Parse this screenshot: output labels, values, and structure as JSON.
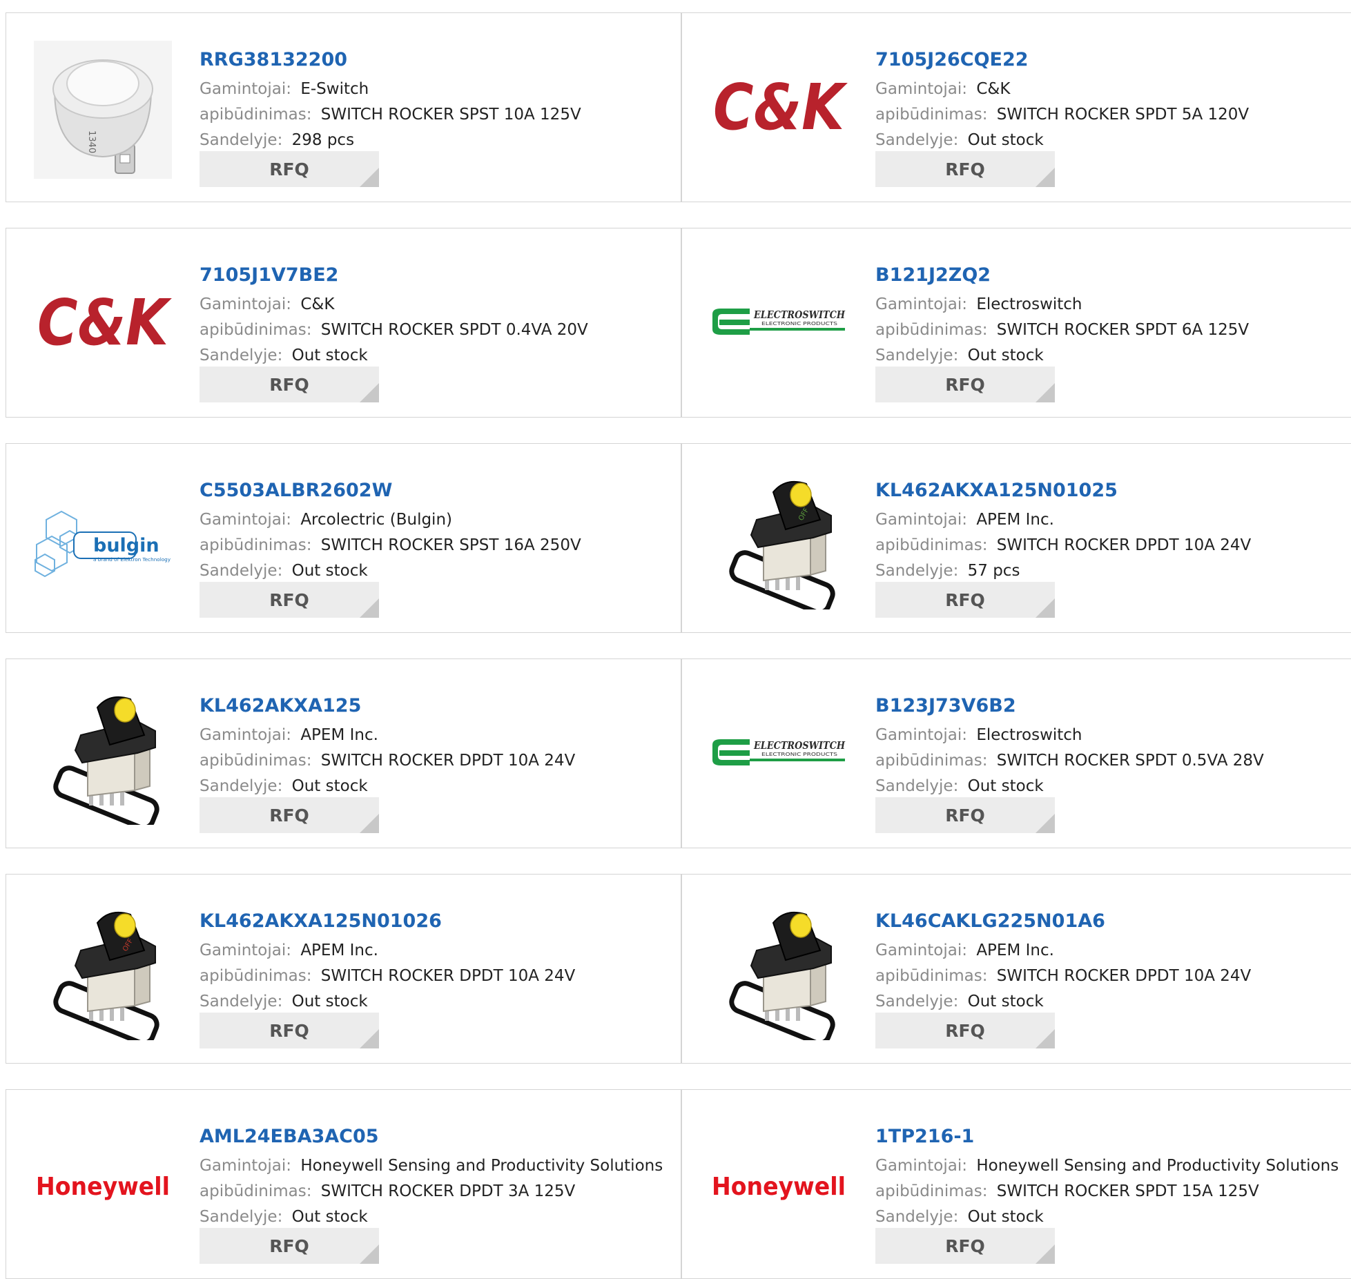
{
  "labels": {
    "manufacturer": "Gamintojai:",
    "description": "apibūdinimas:",
    "stock": "Sandelyje:",
    "rfq": "RFQ"
  },
  "products": [
    {
      "part": "RRG38132200",
      "manufacturer": "E-Switch",
      "description": "SWITCH ROCKER SPST 10A 125V",
      "stock": "298 pcs",
      "image": "round-switch",
      "image_text": "1340"
    },
    {
      "part": "7105J26CQE22",
      "manufacturer": "C&K",
      "description": "SWITCH ROCKER SPDT 5A 120V",
      "stock": "Out stock",
      "image": "ck-logo",
      "image_text": "C&K"
    },
    {
      "part": "7105J1V7BE2",
      "manufacturer": "C&K",
      "description": "SWITCH ROCKER SPDT 0.4VA 20V",
      "stock": "Out stock",
      "image": "ck-logo",
      "image_text": "C&K"
    },
    {
      "part": "B121J2ZQ2",
      "manufacturer": "Electroswitch",
      "description": "SWITCH ROCKER SPDT 6A 125V",
      "stock": "Out stock",
      "image": "electroswitch-logo",
      "image_text": "ELECTROSWITCH",
      "image_subtext": "ELECTRONIC PRODUCTS"
    },
    {
      "part": "C5503ALBR2602W",
      "manufacturer": "Arcolectric (Bulgin)",
      "description": "SWITCH ROCKER SPST 16A 250V",
      "stock": "Out stock",
      "image": "bulgin-logo",
      "image_text": "bulgin",
      "image_subtext": "a brand of Elektron Technology"
    },
    {
      "part": "KL462AKXA125N01025",
      "manufacturer": "APEM Inc.",
      "description": "SWITCH ROCKER DPDT 10A 24V",
      "stock": "57 pcs",
      "image": "rocker-switch",
      "image_text": "OFF",
      "accent": "#5a9a3c"
    },
    {
      "part": "KL462AKXA125",
      "manufacturer": "APEM Inc.",
      "description": "SWITCH ROCKER DPDT 10A 24V",
      "stock": "Out stock",
      "image": "rocker-switch",
      "image_text": "",
      "accent": "#333333"
    },
    {
      "part": "B123J73V6B2",
      "manufacturer": "Electroswitch",
      "description": "SWITCH ROCKER SPDT 0.5VA 28V",
      "stock": "Out stock",
      "image": "electroswitch-logo",
      "image_text": "ELECTROSWITCH",
      "image_subtext": "ELECTRONIC PRODUCTS"
    },
    {
      "part": "KL462AKXA125N01026",
      "manufacturer": "APEM Inc.",
      "description": "SWITCH ROCKER DPDT 10A 24V",
      "stock": "Out stock",
      "image": "rocker-switch",
      "image_text": "OFF",
      "accent": "#c0392b"
    },
    {
      "part": "KL46CAKLG225N01A6",
      "manufacturer": "APEM Inc.",
      "description": "SWITCH ROCKER DPDT 10A 24V",
      "stock": "Out stock",
      "image": "rocker-switch",
      "image_text": "",
      "accent": "#cccccc"
    },
    {
      "part": "AML24EBA3AC05",
      "manufacturer": "Honeywell Sensing and Productivity Solutions",
      "description": "SWITCH ROCKER DPDT 3A 125V",
      "stock": "Out stock",
      "image": "honeywell-logo",
      "image_text": "Honeywell"
    },
    {
      "part": "1TP216-1",
      "manufacturer": "Honeywell Sensing and Productivity Solutions",
      "description": "SWITCH ROCKER SPDT 15A 125V",
      "stock": "Out stock",
      "image": "honeywell-logo",
      "image_text": "Honeywell"
    }
  ],
  "colors": {
    "part_link": "#1f64b2",
    "label": "#8a8a8a",
    "value": "#222222",
    "border": "#d4d4d4",
    "rfq_bg": "#ececec",
    "rfq_corner": "#c8c8c8",
    "ck_red": "#b8222c",
    "electroswitch_green": "#1e9e46",
    "bulgin_blue": "#1a6fb5",
    "honeywell_red": "#e3141e",
    "switch_yellow": "#f5dc29"
  }
}
